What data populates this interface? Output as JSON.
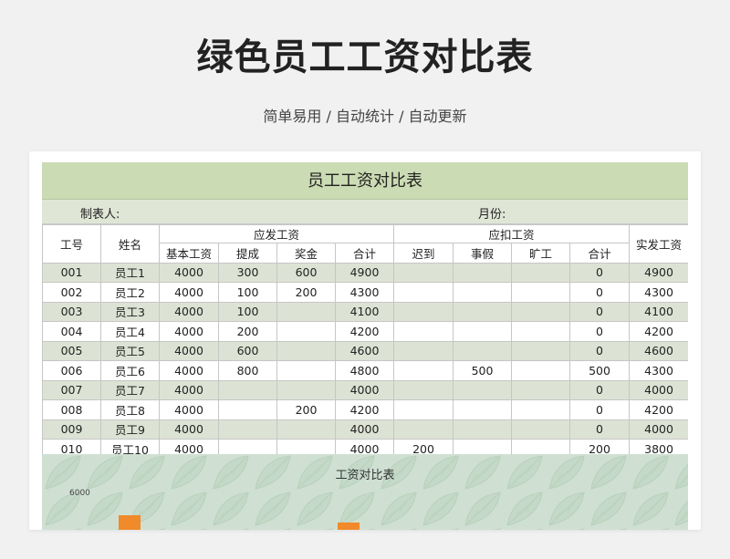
{
  "hero": {
    "title": "绿色员工工资对比表",
    "subtitle": "简单易用 / 自动统计 / 自动更新"
  },
  "sheet": {
    "title": "员工工资对比表",
    "maker_label": "制表人:",
    "month_label": "月份:",
    "headers": {
      "id": "工号",
      "name": "姓名",
      "pay_group": "应发工资",
      "deduct_group": "应扣工资",
      "net": "实发工资",
      "base": "基本工资",
      "commission": "提成",
      "bonus": "奖金",
      "pay_total": "合计",
      "late": "迟到",
      "leave": "事假",
      "absent": "旷工",
      "deduct_total": "合计"
    },
    "rows": [
      {
        "id": "001",
        "name": "员工1",
        "base": "4000",
        "commission": "300",
        "bonus": "600",
        "pay_total": "4900",
        "late": "",
        "leave": "",
        "absent": "",
        "deduct_total": "0",
        "net": "4900"
      },
      {
        "id": "002",
        "name": "员工2",
        "base": "4000",
        "commission": "100",
        "bonus": "200",
        "pay_total": "4300",
        "late": "",
        "leave": "",
        "absent": "",
        "deduct_total": "0",
        "net": "4300"
      },
      {
        "id": "003",
        "name": "员工3",
        "base": "4000",
        "commission": "100",
        "bonus": "",
        "pay_total": "4100",
        "late": "",
        "leave": "",
        "absent": "",
        "deduct_total": "0",
        "net": "4100"
      },
      {
        "id": "004",
        "name": "员工4",
        "base": "4000",
        "commission": "200",
        "bonus": "",
        "pay_total": "4200",
        "late": "",
        "leave": "",
        "absent": "",
        "deduct_total": "0",
        "net": "4200"
      },
      {
        "id": "005",
        "name": "员工5",
        "base": "4000",
        "commission": "600",
        "bonus": "",
        "pay_total": "4600",
        "late": "",
        "leave": "",
        "absent": "",
        "deduct_total": "0",
        "net": "4600"
      },
      {
        "id": "006",
        "name": "员工6",
        "base": "4000",
        "commission": "800",
        "bonus": "",
        "pay_total": "4800",
        "late": "",
        "leave": "500",
        "absent": "",
        "deduct_total": "500",
        "net": "4300"
      },
      {
        "id": "007",
        "name": "员工7",
        "base": "4000",
        "commission": "",
        "bonus": "",
        "pay_total": "4000",
        "late": "",
        "leave": "",
        "absent": "",
        "deduct_total": "0",
        "net": "4000"
      },
      {
        "id": "008",
        "name": "员工8",
        "base": "4000",
        "commission": "",
        "bonus": "200",
        "pay_total": "4200",
        "late": "",
        "leave": "",
        "absent": "",
        "deduct_total": "0",
        "net": "4200"
      },
      {
        "id": "009",
        "name": "员工9",
        "base": "4000",
        "commission": "",
        "bonus": "",
        "pay_total": "4000",
        "late": "",
        "leave": "",
        "absent": "",
        "deduct_total": "0",
        "net": "4000"
      },
      {
        "id": "010",
        "name": "员工10",
        "base": "4000",
        "commission": "",
        "bonus": "",
        "pay_total": "4000",
        "late": "200",
        "leave": "",
        "absent": "",
        "deduct_total": "200",
        "net": "3800"
      }
    ]
  },
  "chart": {
    "title": "工资对比表",
    "tick_top": "6000",
    "bar_color": "#f08a2a"
  }
}
